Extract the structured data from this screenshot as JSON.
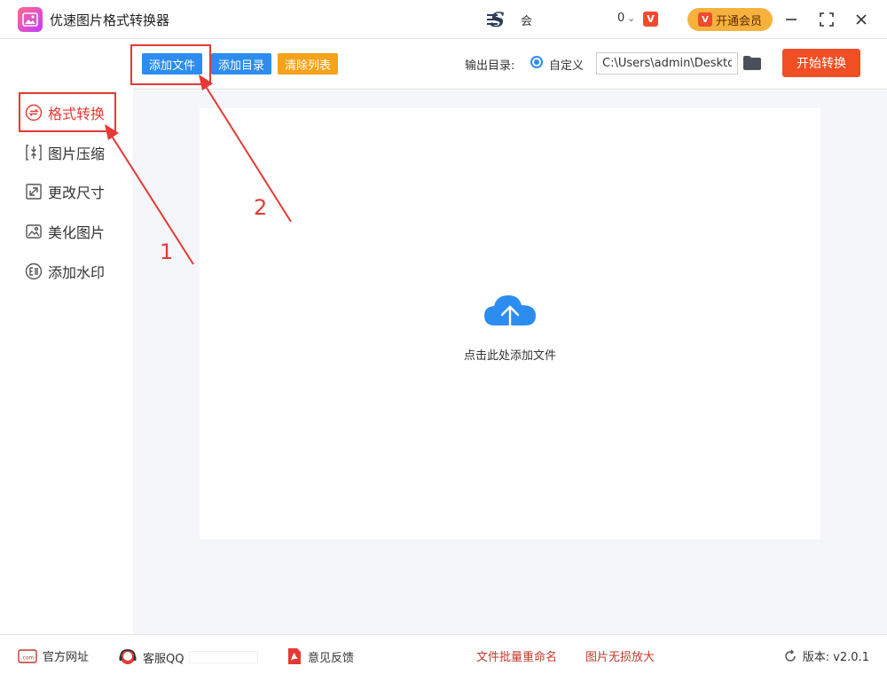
{
  "app": {
    "title": "优速图片格式转换器"
  },
  "header": {
    "user_name": "会",
    "coin_count": "0",
    "coin_chevron": "⌄",
    "vip_label": "开通会员",
    "vip_icon_text": "V",
    "coin_icon_text": "V"
  },
  "sidebar": {
    "items": [
      {
        "label": "格式转换",
        "icon": "format-convert-icon",
        "active": true
      },
      {
        "label": "图片压缩",
        "icon": "compress-icon"
      },
      {
        "label": "更改尺寸",
        "icon": "resize-icon"
      },
      {
        "label": "美化图片",
        "icon": "beautify-icon"
      },
      {
        "label": "添加水印",
        "icon": "watermark-icon"
      }
    ]
  },
  "toolbar": {
    "add_file": "添加文件",
    "add_dir": "添加目录",
    "clear_list": "清除列表",
    "output_label": "输出目录:",
    "radio_label": "自定义",
    "output_path": "C:\\Users\\admin\\Desktop",
    "start_button": "开始转换"
  },
  "main": {
    "drop_text": "点击此处添加文件"
  },
  "annotations": {
    "label_1": "1",
    "label_2": "2"
  },
  "footer": {
    "website": "官方网址",
    "qq": "客服QQ",
    "feedback": "意见反馈",
    "batch_rename": "文件批量重命名",
    "enlarge": "图片无损放大",
    "version": "版本: v2.0.1",
    "com_text": ".com"
  },
  "colors": {
    "accent_blue": "#2d8cf0",
    "accent_orange": "#f7a21b",
    "start_red": "#f04e23",
    "annotation_red": "#e53935",
    "vip_gold": "#f7b13d"
  }
}
